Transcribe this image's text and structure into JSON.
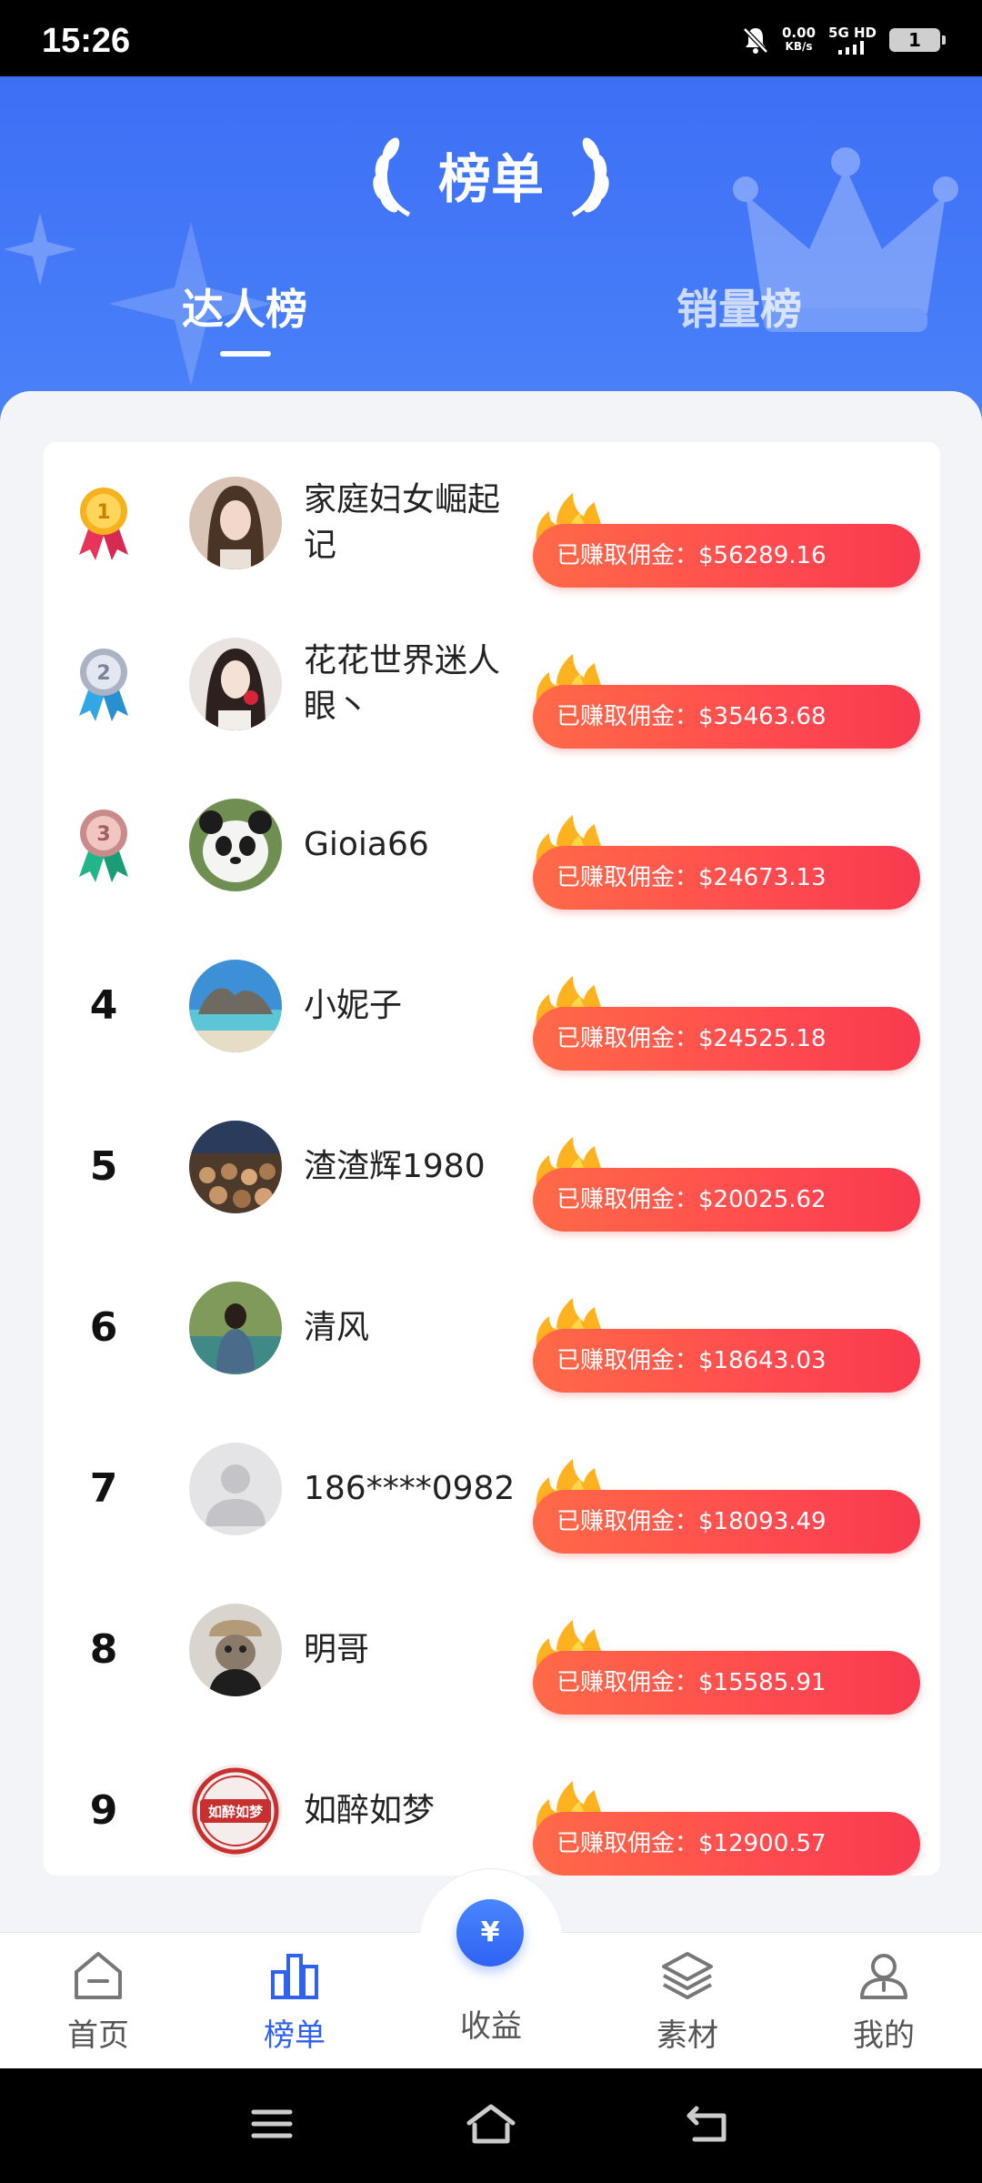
{
  "status_bar": {
    "time": "15:26",
    "net_speed": "0.00",
    "net_unit": "KB/s",
    "signal": "5G HD",
    "battery": "1"
  },
  "header": {
    "title": "榜单",
    "tabs": [
      {
        "label": "达人榜",
        "active": true
      },
      {
        "label": "销量榜",
        "active": false
      }
    ]
  },
  "ranking": [
    {
      "rank": "1",
      "medal": "gold-medal-icon",
      "name": "家庭妇女崛起记",
      "reward": "已赚取佣金：$56289.16",
      "avatar": "avatar-woman-1"
    },
    {
      "rank": "2",
      "medal": "silver-medal-icon",
      "name": "花花世界迷人眼丶",
      "reward": "已赚取佣金：$35463.68",
      "avatar": "avatar-woman-2"
    },
    {
      "rank": "3",
      "medal": "bronze-medal-icon",
      "name": "Gioia66",
      "reward": "已赚取佣金：$24673.13",
      "avatar": "avatar-panda"
    },
    {
      "rank": "4",
      "name": "小妮子",
      "reward": "已赚取佣金：$24525.18",
      "avatar": "avatar-beach"
    },
    {
      "rank": "5",
      "name": "渣渣辉1980",
      "reward": "已赚取佣金：$20025.62",
      "avatar": "avatar-crowd"
    },
    {
      "rank": "6",
      "name": "清风",
      "reward": "已赚取佣金：$18643.03",
      "avatar": "avatar-lake"
    },
    {
      "rank": "7",
      "name": "186****0982",
      "reward": "已赚取佣金：$18093.49",
      "avatar": "avatar-default"
    },
    {
      "rank": "8",
      "name": "明哥",
      "reward": "已赚取佣金：$15585.91",
      "avatar": "avatar-cat"
    },
    {
      "rank": "9",
      "name": "如醉如梦",
      "reward": "已赚取佣金：$12900.57",
      "avatar": "avatar-stamp",
      "avatar_text": "如醉如梦"
    }
  ],
  "bottom_nav": {
    "items": [
      {
        "label": "首页",
        "icon": "home-icon",
        "active": false
      },
      {
        "label": "榜单",
        "icon": "ranking-icon",
        "active": true
      },
      {
        "label": "收益",
        "icon": "yuan-icon",
        "active": false
      },
      {
        "label": "素材",
        "icon": "layers-icon",
        "active": false
      },
      {
        "label": "我的",
        "icon": "profile-icon",
        "active": false
      }
    ],
    "center_symbol": "¥"
  },
  "colors": {
    "header_blue": "#3d6ff6",
    "accent_blue": "#2f62f2",
    "pill_red": "#ff4b4f",
    "flame_yellow": "#ffd23a"
  }
}
